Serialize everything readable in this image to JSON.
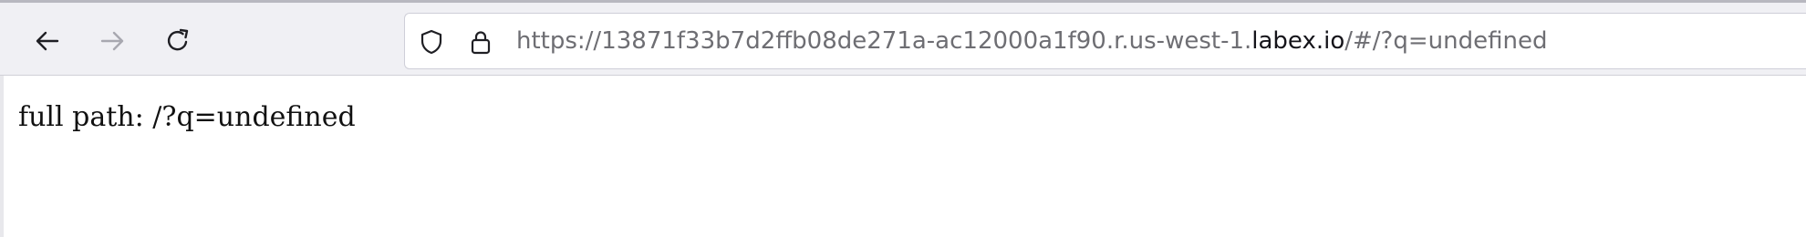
{
  "browser": {
    "nav": {
      "back_icon": "arrow-left-icon",
      "forward_icon": "arrow-right-icon",
      "reload_icon": "reload-icon"
    },
    "urlbar": {
      "shield_icon": "shield-icon",
      "lock_icon": "lock-icon",
      "url_prefix": "https://13871f33b7d2ffb08de271a-ac12000a1f90.r.us-west-1.",
      "url_host": "labex.io",
      "url_suffix": "/#/?q=undefined"
    }
  },
  "page": {
    "label": "full path: ",
    "path": "/?q=undefined"
  },
  "colors": {
    "toolbar_bg": "#f0f0f4",
    "url_dim": "#6e6e73",
    "url_host": "#15141a",
    "forward_disabled": "#a8a8b0"
  }
}
